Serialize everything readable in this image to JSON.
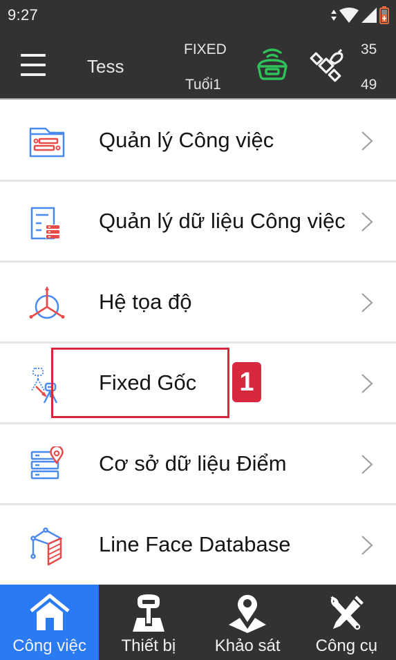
{
  "status_bar": {
    "time": "9:27",
    "icons": [
      "data-arrows-icon",
      "wifi-icon",
      "cell-signal-icon",
      "battery-charging-icon"
    ],
    "battery_color": "#e8693c"
  },
  "app_bar": {
    "menu_icon": "hamburger-menu-icon",
    "project_name": "Tess",
    "fix_status": "FIXED",
    "age_label": "Tuổi1",
    "receiver_icon": "gnss-receiver-icon",
    "receiver_color": "#2fc15a",
    "satellite_icon": "satellite-icon",
    "satellites_used": "35",
    "satellites_total": "49"
  },
  "menu": {
    "items": [
      {
        "label": "Quản lý Công việc",
        "icon": "job-folder-icon"
      },
      {
        "label": "Quản lý dữ liệu Công việc",
        "icon": "job-data-icon"
      },
      {
        "label": "Hệ tọa độ",
        "icon": "coordinate-system-icon"
      },
      {
        "label": "Fixed Gốc",
        "icon": "base-station-icon"
      },
      {
        "label": "Cơ sở dữ liệu Điểm",
        "icon": "point-database-icon"
      },
      {
        "label": "Line Face Database",
        "icon": "line-face-database-icon"
      }
    ]
  },
  "annotation": {
    "badge": "1",
    "target": "Fixed Gốc",
    "color": "#d8273c"
  },
  "bottom_nav": {
    "active_index": 0,
    "active_color": "#2a7af4",
    "tabs": [
      {
        "label": "Công việc",
        "icon": "home-icon"
      },
      {
        "label": "Thiết bị",
        "icon": "device-icon"
      },
      {
        "label": "Khảo sát",
        "icon": "survey-pin-icon"
      },
      {
        "label": "Công cụ",
        "icon": "tools-icon"
      }
    ]
  }
}
